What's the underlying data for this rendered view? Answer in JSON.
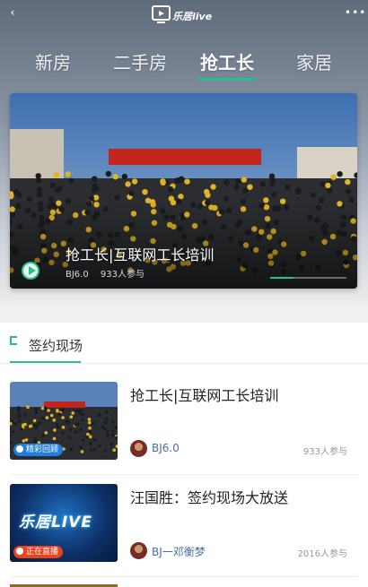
{
  "header": {
    "logo_text": "乐居live",
    "back_glyph": "‹",
    "more_glyph": "•••"
  },
  "tabs": [
    {
      "label": "新房",
      "active": false
    },
    {
      "label": "二手房",
      "active": false
    },
    {
      "label": "抢工长",
      "active": true
    },
    {
      "label": "家居",
      "active": false
    }
  ],
  "banner": {
    "title": "抢工长|互联网工长培训",
    "author": "BJ6.0",
    "joined": "933人参与",
    "progress": 0.3
  },
  "section": {
    "title": "签约现场",
    "items": [
      {
        "title": "抢工长|互联网工长培训",
        "badge": "精彩回顾",
        "badge_color": "#1f7de0",
        "author": "BJ6.0",
        "joined": "933人参与",
        "thumb_kind": "crowd"
      },
      {
        "title": "汪国胜：签约现场大放送",
        "badge": "正在直播",
        "badge_color": "#e8431e",
        "author": "BJ一邓衡梦",
        "joined": "2016人参与",
        "thumb_kind": "logo",
        "thumb_logo": "乐居LIVE"
      }
    ]
  },
  "colors": {
    "accent": "#2bbd8a",
    "author": "#4a6fa5"
  },
  "icons": {
    "back": "chevron-left-icon",
    "more": "more-dots-icon",
    "play": "play-icon",
    "section": "section-bracket-icon",
    "replay": "replay-icon",
    "live": "live-icon"
  }
}
